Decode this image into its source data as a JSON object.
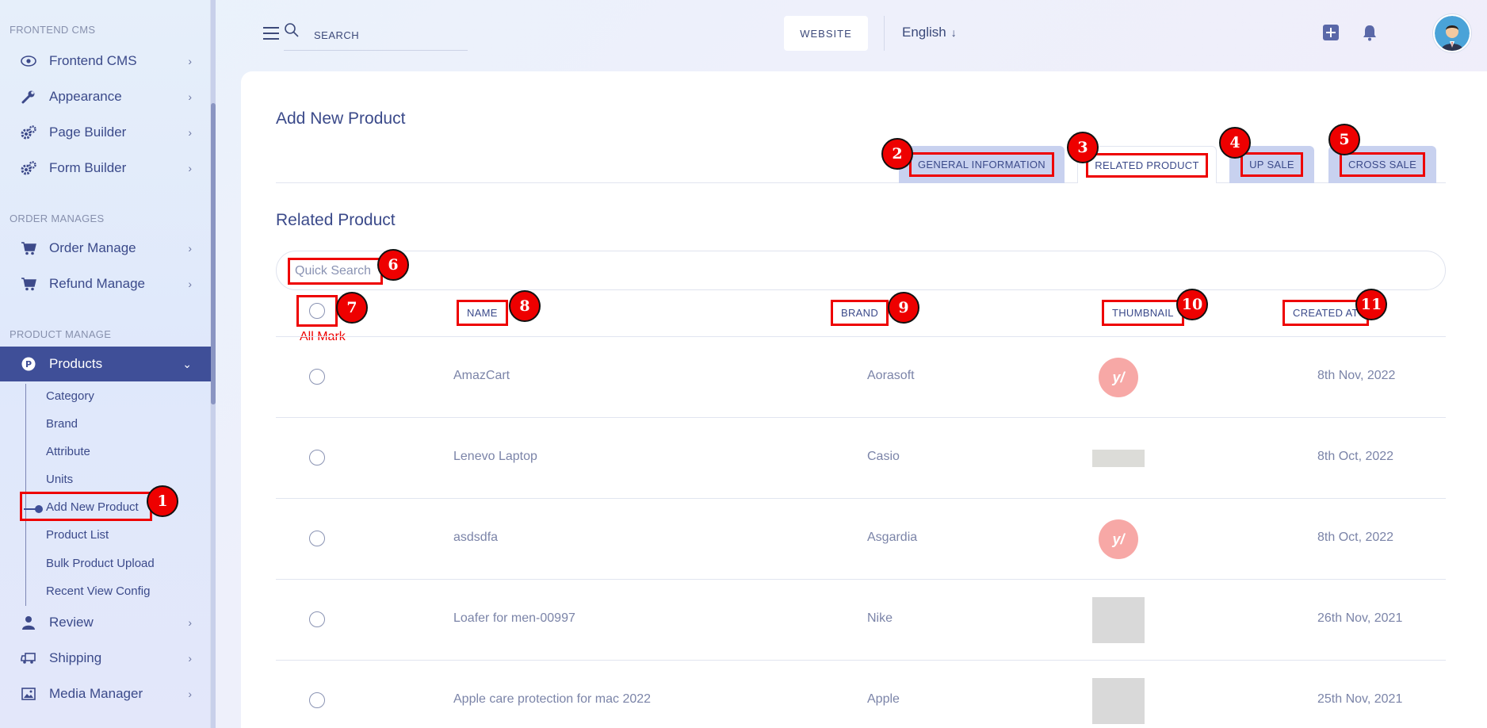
{
  "sidebar": {
    "sections": [
      {
        "label": "FRONTEND CMS"
      },
      {
        "label": "ORDER MANAGES"
      },
      {
        "label": "PRODUCT MANAGE"
      }
    ],
    "items": [
      {
        "label": "Frontend CMS",
        "icon": "eye-icon"
      },
      {
        "label": "Appearance",
        "icon": "wrench-icon"
      },
      {
        "label": "Page Builder",
        "icon": "gears-icon"
      },
      {
        "label": "Form Builder",
        "icon": "gears-icon"
      },
      {
        "label": "Order Manage",
        "icon": "cart-icon"
      },
      {
        "label": "Refund Manage",
        "icon": "cart-icon"
      },
      {
        "label": "Products",
        "icon": "product-icon"
      },
      {
        "label": "Review",
        "icon": "user-icon"
      },
      {
        "label": "Shipping",
        "icon": "truck-icon"
      },
      {
        "label": "Media Manager",
        "icon": "image-icon"
      }
    ],
    "product_sub": [
      "Category",
      "Brand",
      "Attribute",
      "Units",
      "Add New Product",
      "Product List",
      "Bulk Product Upload",
      "Recent View Config"
    ]
  },
  "header": {
    "search_placeholder": "SEARCH",
    "website_label": "WEBSITE",
    "language": "English",
    "language_arrow": "↓"
  },
  "main": {
    "title": "Add New Product",
    "tabs": [
      "GENERAL INFORMATION",
      "RELATED PRODUCT",
      "UP SALE",
      "CROSS SALE"
    ],
    "section_title": "Related Product",
    "quick_search_placeholder": "Quick Search",
    "all_mark": "All Mark",
    "columns": [
      "NAME",
      "BRAND",
      "THUMBNAIL",
      "CREATED AT"
    ],
    "rows": [
      {
        "name": "AmazCart",
        "brand": "Aorasoft",
        "created": "8th Nov, 2022",
        "thumb": "logo"
      },
      {
        "name": "Lenevo Laptop",
        "brand": "Casio",
        "created": "8th Oct, 2022",
        "thumb": "flat"
      },
      {
        "name": "asdsdfa",
        "brand": "Asgardia",
        "created": "8th Oct, 2022",
        "thumb": "logo"
      },
      {
        "name": "Loafer for men-00997",
        "brand": "Nike",
        "created": "26th Nov, 2021",
        "thumb": "rect"
      },
      {
        "name": "Apple care protection for mac 2022",
        "brand": "Apple",
        "created": "25th Nov, 2021",
        "thumb": "rect"
      }
    ],
    "thumb_logo_text": "y/"
  },
  "badges": [
    "1",
    "2",
    "3",
    "4",
    "5",
    "6",
    "7",
    "8",
    "9",
    "10",
    "11"
  ],
  "colors": {
    "accent": "#3f4f98",
    "annotation": "#e00000"
  }
}
